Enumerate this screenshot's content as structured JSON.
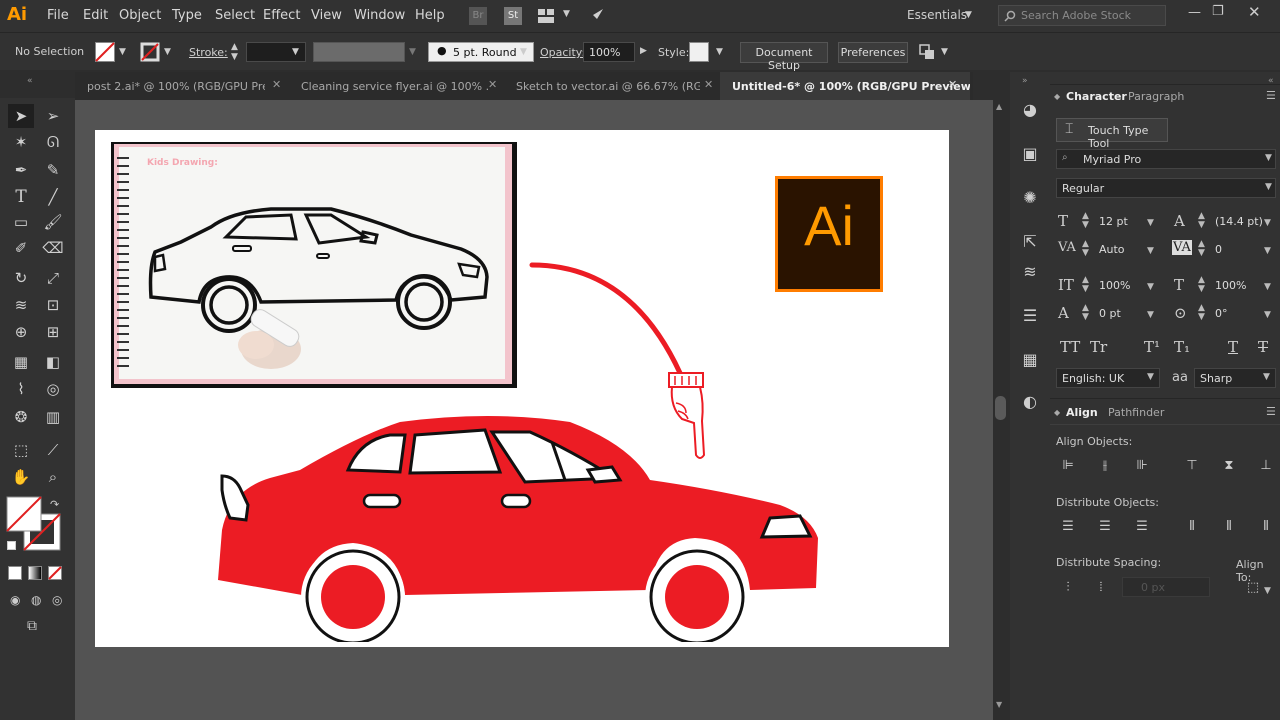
{
  "app": {
    "logo": "Ai",
    "accent": "#ff9a00"
  },
  "menu": [
    "File",
    "Edit",
    "Object",
    "Type",
    "Select",
    "Effect",
    "View",
    "Window",
    "Help"
  ],
  "menu_icons": {
    "bridge": "Br",
    "stock": "St"
  },
  "workspace": "Essentials",
  "search": {
    "placeholder": "Search Adobe Stock"
  },
  "control_bar": {
    "selection": "No Selection",
    "stroke_label": "Stroke:",
    "brush": "5 pt. Round",
    "opacity_label": "Opacity:",
    "opacity": "100%",
    "style_label": "Style:",
    "doc_setup": "Document Setup",
    "preferences": "Preferences"
  },
  "tabs": [
    {
      "label": "post 2.ai* @ 100% (RGB/GPU Pre...",
      "active": false
    },
    {
      "label": "Cleaning service flyer.ai @ 100% ...",
      "active": false
    },
    {
      "label": "Sketch to vector.ai @ 66.67% (RG...",
      "active": false
    },
    {
      "label": "Untitled-6* @ 100% (RGB/GPU Preview)",
      "active": true
    }
  ],
  "artwork": {
    "sketch_caption": "Kids Drawing:",
    "logo_text": "Ai",
    "car_color": "#ec1c24",
    "logo_bg": "#2a1300",
    "logo_border": "#ff7d00",
    "logo_text_color": "#ff9a00"
  },
  "character_panel": {
    "tab_character": "Character",
    "tab_paragraph": "Paragraph",
    "touch_type": "Touch Type Tool",
    "font_family": "Myriad Pro",
    "font_style": "Regular",
    "size": "12 pt",
    "leading": "(14.4 pt)",
    "kerning": "Auto",
    "tracking": "0",
    "vscale": "100%",
    "hscale": "100%",
    "baseline": "0 pt",
    "rotation": "0°",
    "language": "English: UK",
    "aa_symbol": "aa",
    "antialias": "Sharp",
    "typo_buttons": [
      "TT",
      "Tr",
      "T¹",
      "T₁",
      "T",
      "T"
    ]
  },
  "align_panel": {
    "tab_align": "Align",
    "tab_pathfinder": "Pathfinder",
    "align_objects": "Align Objects:",
    "distribute_objects": "Distribute Objects:",
    "distribute_spacing": "Distribute Spacing:",
    "align_to": "Align To:",
    "spacing_value": "0 px"
  }
}
